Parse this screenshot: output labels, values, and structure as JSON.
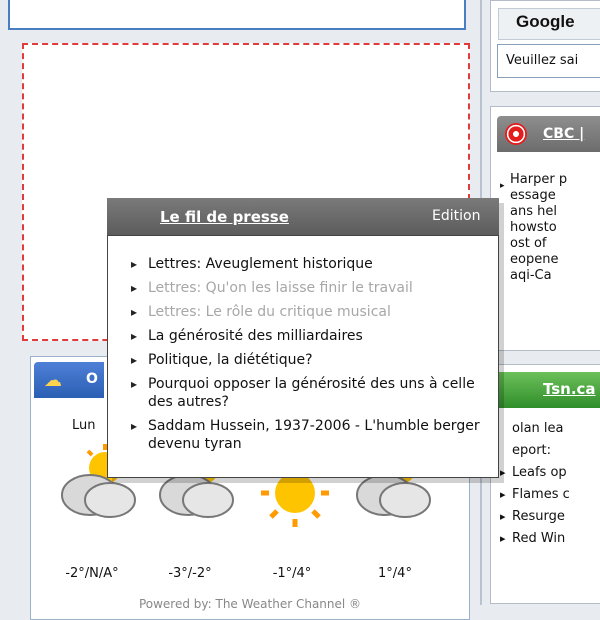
{
  "google": {
    "title": "Google",
    "input_value": "Veuillez sai"
  },
  "cbc": {
    "title": "CBC |",
    "items": [
      "Harper p",
      "essage",
      "ans hel",
      "howsto",
      "ost of",
      "eopene",
      "aqi-Ca"
    ]
  },
  "tsn": {
    "title": "Tsn.ca",
    "items": [
      "olan lea",
      "eport:",
      "Leafs op",
      "Flames c",
      "Resurge",
      "Red Win"
    ]
  },
  "weather": {
    "header_title": "O",
    "day_label": "Lun",
    "temps": [
      "-2°/N/A°",
      "-3°/-2°",
      "-1°/4°",
      "1°/4°"
    ],
    "icons": [
      "partly-cloudy-icon",
      "partly-cloudy-icon",
      "sunny-icon",
      "partly-cloudy-icon"
    ],
    "powered_by": "Powered by: The Weather Channel ®"
  },
  "popup": {
    "title": "Le fil de presse",
    "edit_label": "Edition",
    "items": [
      {
        "text": "Lettres: Aveuglement historique",
        "dim": false
      },
      {
        "text": "Lettres: Qu'on les laisse finir le travail",
        "dim": true
      },
      {
        "text": "Lettres: Le rôle du critique musical",
        "dim": true
      },
      {
        "text": "La générosité des milliardaires",
        "dim": false
      },
      {
        "text": "Politique, la diététique?",
        "dim": false
      },
      {
        "text": "Pourquoi opposer la générosité des uns à celle des autres?",
        "dim": false
      },
      {
        "text": "Saddam Hussein, 1937-2006 - L'humble berger devenu tyran",
        "dim": false
      }
    ]
  },
  "colors": {
    "accent_blue": "#4a7ec2",
    "dash_red": "#e23b3b",
    "tsn_green": "#2f8e2a",
    "cbc_red": "#e41d1d"
  }
}
